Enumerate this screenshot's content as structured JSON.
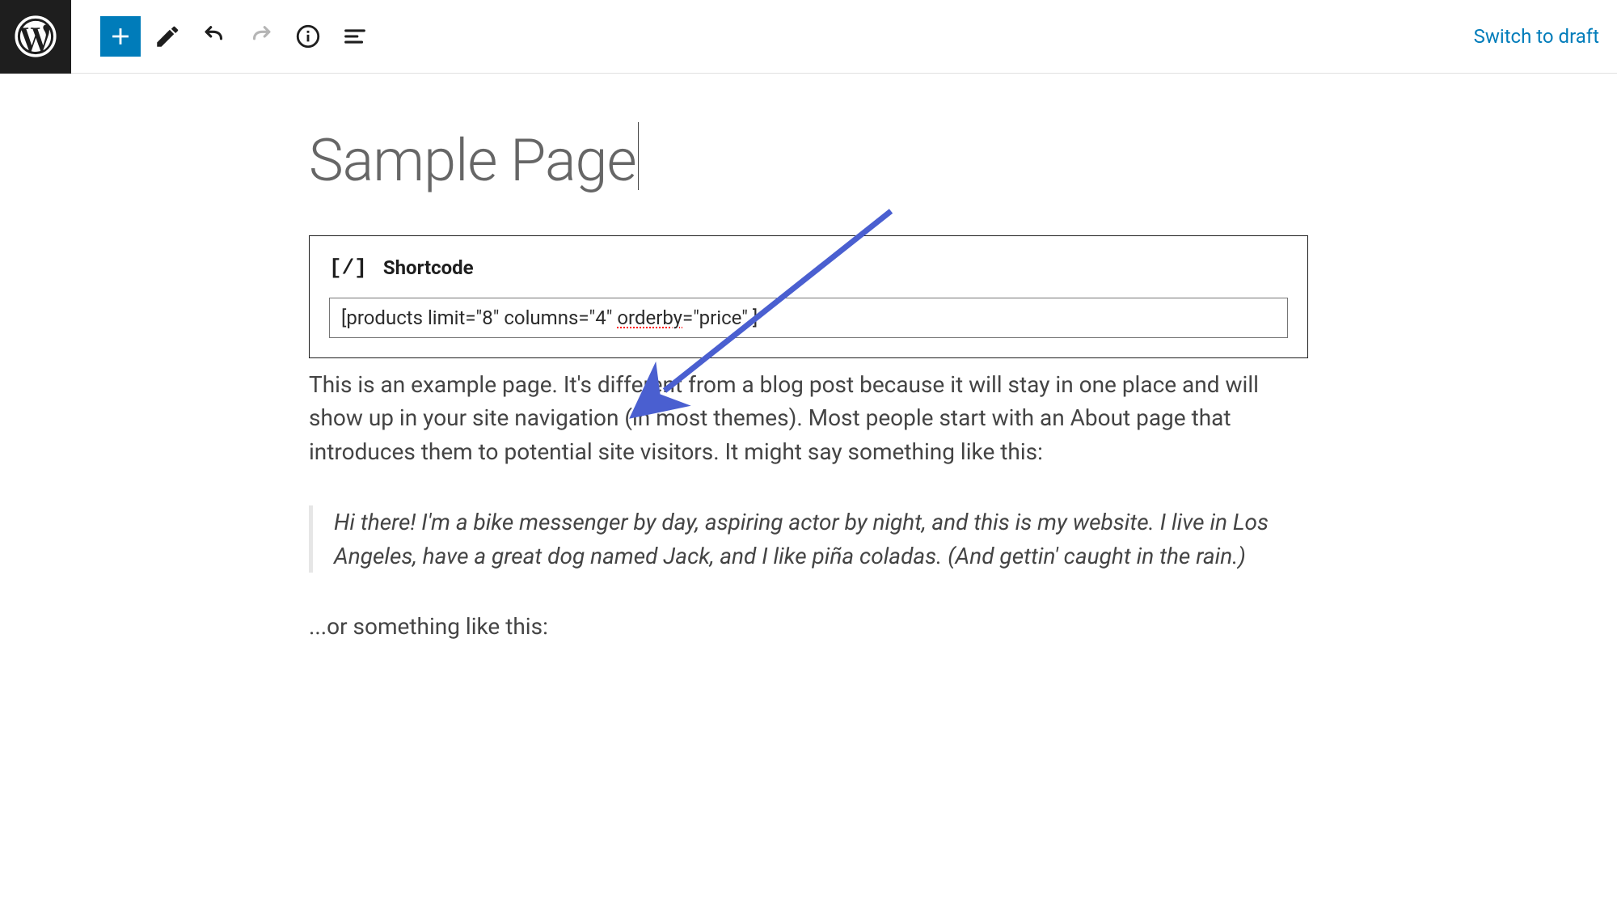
{
  "toolbar": {
    "switch_to_draft": "Switch to draft"
  },
  "page": {
    "title": "Sample Page",
    "paragraph1": "This is an example page. It's different from a blog post because it will stay in one place and will show up in your site navigation (in most themes). Most people start with an About page that introduces them to potential site visitors. It might say something like this:",
    "quote": "Hi there! I'm a bike messenger by day, aspiring actor by night, and this is my website. I live in Los Angeles, have a great dog named Jack, and I like piña coladas. (And gettin' caught in the rain.)",
    "paragraph2": "...or something like this:"
  },
  "shortcode_block": {
    "label": "Shortcode",
    "icon_text": "[/]",
    "value_prefix": "[products limit=\"8\" columns=\"4\" ",
    "value_spell": "orderby",
    "value_suffix": "=\"price\" ]"
  }
}
